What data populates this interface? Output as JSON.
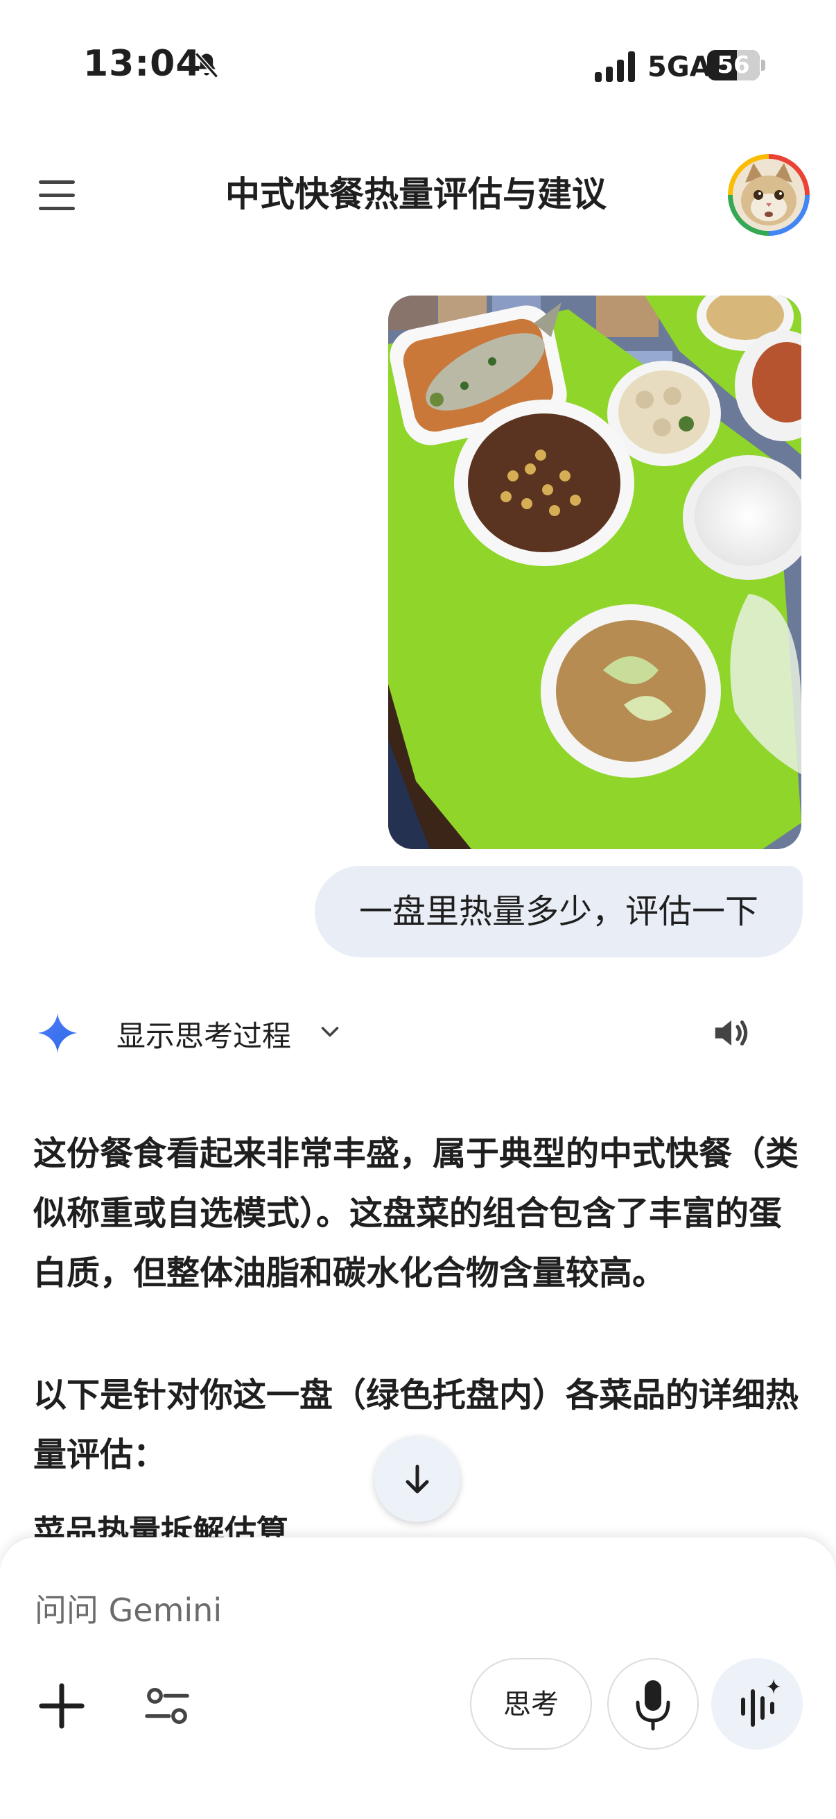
{
  "status_bar": {
    "time": "13:04",
    "network": "5GA",
    "battery_level": "56",
    "icons": [
      "bell-off-icon",
      "signal-icon",
      "battery-icon"
    ]
  },
  "header": {
    "title": "中式快餐热量评估与建议",
    "icons": [
      "menu-icon",
      "avatar"
    ]
  },
  "conversation": {
    "user_message": "一盘里热量多少，评估一下",
    "show_thinking_label": "显示思考过程",
    "response_paragraph_1": "这份餐食看起来非常丰盛，属于典型的中式快餐（类似称重或自选模式）。这盘菜的组合包含了丰富的蛋白质，但整体油脂和碳水化合物含量较高。",
    "response_paragraph_2": "以下是针对你这一盘（绿色托盘内）各菜品的详细热量评估：",
    "section_heading": "菜品热量拆解估算"
  },
  "input": {
    "placeholder": "问问 Gemini",
    "think_button_label": "思考"
  },
  "colors": {
    "accent_blue": "#4285f4",
    "bubble_bg": "#e9eef6",
    "tray_green": "#8fd52a"
  }
}
